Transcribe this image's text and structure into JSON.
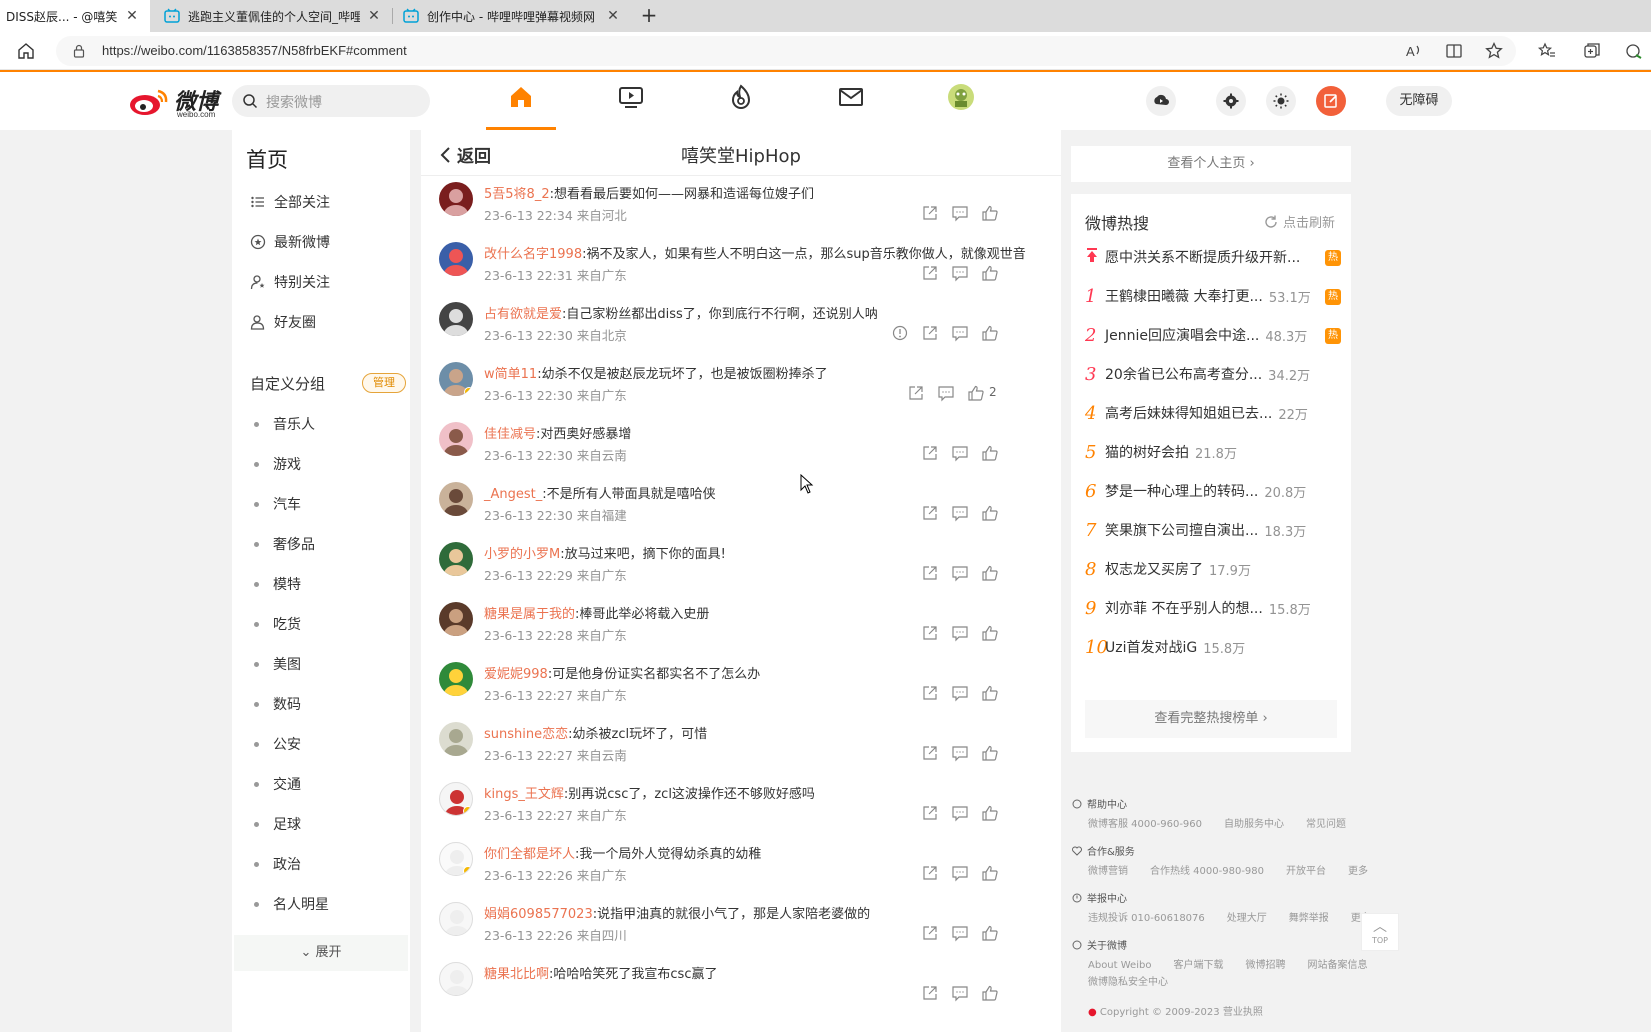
{
  "browser": {
    "tabs": [
      {
        "title": "DISS赵辰... - @嘻笑堂H"
      },
      {
        "title": "逃跑主义董佩佳的个人空间_哔哩"
      },
      {
        "title": "创作中心 - 哔哩哔哩弹幕视频网"
      }
    ],
    "url": "https://weibo.com/1163858357/N58frbEKF#comment"
  },
  "nav": {
    "logo_text": "微博",
    "logo_sub": "weibo.com",
    "search_placeholder": "搜索微博",
    "accessibility_label": "无障碍"
  },
  "sidebar": {
    "heading": "首页",
    "menu": [
      "全部关注",
      "最新微博",
      "特别关注",
      "好友圈"
    ],
    "group_heading": "自定义分组",
    "manage_label": "管理",
    "groups": [
      "音乐人",
      "游戏",
      "汽车",
      "奢侈品",
      "模特",
      "吃货",
      "美图",
      "数码",
      "公安",
      "交通",
      "足球",
      "政治",
      "名人明星"
    ],
    "expand_label": "展开"
  },
  "main": {
    "back_label": "返回",
    "title": "嘻笑堂HipHop",
    "comments": [
      {
        "user": "5吾5将8_2",
        "text": ":想看看最后要如何——网暴和造谣每位嫂子们",
        "meta": "23-6-13 22:34 来自河北"
      },
      {
        "user": "改什么名字1998",
        "text": ":祸不及家人，如果有些人不明白这一点，那么sup音乐教你做人，就像观世音",
        "meta": "23-6-13 22:31 来自广东"
      },
      {
        "user": "占有欲就是爱",
        "text": ":自己家粉丝都出diss了，你到底行不行啊，还说别人呐",
        "meta": "23-6-13 22:30 来自北京"
      },
      {
        "user": "w简单11",
        "text": ":幼杀不仅是被赵辰龙玩坏了，也是被饭圈粉捧杀了",
        "meta": "23-6-13 22:30 来自广东",
        "likes": "2"
      },
      {
        "user": "佳佳减号",
        "text": ":对西奥好感暴增",
        "meta": "23-6-13 22:30 来自云南"
      },
      {
        "user": "_Angest_",
        "text": ":不是所有人带面具就是嘻哈侠",
        "meta": "23-6-13 22:30 来自福建"
      },
      {
        "user": "小罗的小罗M",
        "text": ":放马过来吧，摘下你的面具!",
        "meta": "23-6-13 22:29 来自广东"
      },
      {
        "user": "糖果是属于我的",
        "text": ":棒哥此举必将载入史册",
        "meta": "23-6-13 22:28 来自广东"
      },
      {
        "user": "爱妮妮998",
        "text": ":可是他身份证实名都实名不了怎么办",
        "meta": "23-6-13 22:27 来自广东"
      },
      {
        "user": "sunshine恋恋",
        "text": ":幼杀被zcl玩坏了，可惜",
        "meta": "23-6-13 22:27 来自云南"
      },
      {
        "user": "kings_王文辉",
        "text": ":别再说csc了，zcl这波操作还不够败好感吗",
        "meta": "23-6-13 22:27 来自广东"
      },
      {
        "user": "你们全都是坏人",
        "text": ":我一个局外人觉得幼杀真的幼稚",
        "meta": "23-6-13 22:26 来自广东"
      },
      {
        "user": "娟娟6098577023",
        "text": ":说指甲油真的就很小气了，那是人家陪老婆做的",
        "meta": "23-6-13 22:26 来自四川"
      },
      {
        "user": "糖果北比啊",
        "text": ":哈哈哈笑死了我宣布csc赢了",
        "meta": ""
      }
    ]
  },
  "right": {
    "profile_link": "查看个人主页",
    "hot_heading": "微博热搜",
    "refresh_label": "点击刷新",
    "hot_items": [
      {
        "rank": "",
        "title": "愿中洪关系不断提质升级开新...",
        "num": "",
        "tag": "热"
      },
      {
        "rank": "1",
        "title": "王鹤棣田曦薇 大奉打更...",
        "num": "53.1万",
        "tag": "热"
      },
      {
        "rank": "2",
        "title": "Jennie回应演唱会中途...",
        "num": "48.3万",
        "tag": "热"
      },
      {
        "rank": "3",
        "title": "20余省已公布高考查分...",
        "num": "34.2万",
        "tag": ""
      },
      {
        "rank": "4",
        "title": "高考后妹妹得知姐姐已去...",
        "num": "22万",
        "tag": ""
      },
      {
        "rank": "5",
        "title": "猫的树好会拍",
        "num": "21.8万",
        "tag": ""
      },
      {
        "rank": "6",
        "title": "梦是一种心理上的转码...",
        "num": "20.8万",
        "tag": ""
      },
      {
        "rank": "7",
        "title": "笑果旗下公司擅自演出...",
        "num": "18.3万",
        "tag": ""
      },
      {
        "rank": "8",
        "title": "权志龙又买房了",
        "num": "17.9万",
        "tag": ""
      },
      {
        "rank": "9",
        "title": "刘亦菲 不在乎别人的想...",
        "num": "15.8万",
        "tag": ""
      },
      {
        "rank": "10",
        "title": "Uzi首发对战iG",
        "num": "15.8万",
        "tag": ""
      }
    ],
    "full_list_label": "查看完整热搜榜单",
    "footer": {
      "help_title": "帮助中心",
      "help_links": [
        "微博客服 4000-960-960",
        "自助服务中心",
        "常见问题"
      ],
      "coop_title": "合作&服务",
      "coop_links": [
        "微博营销",
        "合作热线 4000-980-980",
        "开放平台",
        "更多"
      ],
      "report_title": "举报中心",
      "report_links": [
        "违规投诉 010-60618076",
        "处理大厅",
        "舞弊举报",
        "更多"
      ],
      "about_title": "关于微博",
      "about_links": [
        "About Weibo",
        "客户端下载",
        "微博招聘",
        "网站备案信息"
      ],
      "about_links2": [
        "微博隐私安全中心"
      ],
      "copyright": "Copyright © 2009-2023 营业执照"
    },
    "top_label": "TOP"
  },
  "colors": {
    "accent": "#ff8200",
    "username": "#eb7350",
    "hot_tag": "#ff9406"
  }
}
